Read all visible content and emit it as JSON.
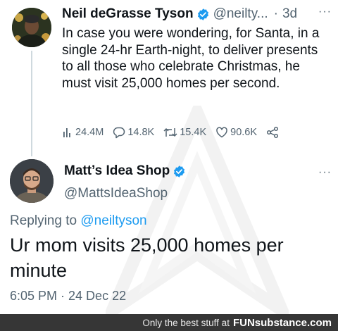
{
  "tweet1": {
    "author_name": "Neil deGrasse Tyson",
    "handle": "@neilty...",
    "separator": "·",
    "time": "3d",
    "more_label": "···",
    "text": "In case you were wondering, for Santa, in a single 24-hr Earth-night, to deliver presents to all those who celebrate Christmas, he must visit 25,000 homes per second.",
    "stats": {
      "views": "24.4M",
      "replies": "14.8K",
      "retweets": "15.4K",
      "likes": "90.6K"
    }
  },
  "tweet2": {
    "author_name": "Matt’s Idea Shop",
    "handle": "@MattsIdeaShop",
    "more_label": "···",
    "replying_prefix": "Replying to",
    "replying_to": "@neiltyson",
    "text": "Ur mom visits 25,000 homes per minute",
    "timestamp": "6:05 PM · 24 Dec 22"
  },
  "footer": {
    "tagline": "Only the best stuff at",
    "brand": "FUNsubstance.com"
  },
  "colors": {
    "verified": "#1d9bf0",
    "link": "#1d9bf0",
    "muted_text": "#536471",
    "footer_bg": "#363636"
  },
  "icons": {
    "views": "bar-chart-icon",
    "replies": "speech-bubble-icon",
    "retweets": "retweet-icon",
    "likes": "heart-icon",
    "share": "share-icon",
    "verified": "verified-badge-icon"
  }
}
